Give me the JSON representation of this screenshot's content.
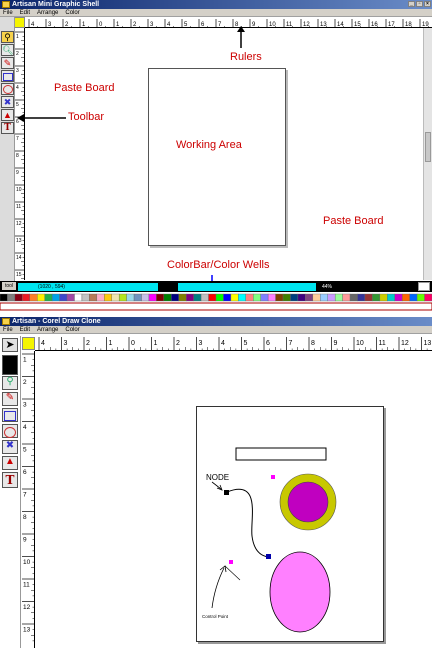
{
  "top_window": {
    "title": "Artisan Mini Graphic Shell",
    "menu": [
      "File",
      "Edit",
      "Arrange",
      "Color"
    ],
    "ruler_numbers": [
      "4",
      "3",
      "2",
      "1",
      "0",
      "1",
      "2",
      "3",
      "4",
      "5",
      "6",
      "7",
      "8",
      "9",
      "10",
      "11",
      "12",
      "13",
      "14",
      "15",
      "16",
      "17",
      "18",
      "19"
    ],
    "status_coords": "(1020 , 594)",
    "status_zoom": "44%",
    "status_tool": "tool",
    "annotations": {
      "rulers": "Rulers",
      "paste_board_left": "Paste Board",
      "toolbar": "Toolbar",
      "working_area": "Working Area",
      "paste_board_right": "Paste Board",
      "colorbar": "ColorBar/Color Wells"
    }
  },
  "bottom_window": {
    "title": "Artisan - Corel Draw Clone",
    "menu": [
      "File",
      "Edit",
      "Arrange",
      "Color"
    ],
    "ruler_numbers": [
      "4",
      "3",
      "2",
      "1",
      "0",
      "1",
      "2",
      "3",
      "4",
      "5",
      "6",
      "7",
      "8",
      "9",
      "10",
      "11",
      "12",
      "13"
    ],
    "vruler_numbers": [
      "1",
      "2",
      "3",
      "4",
      "5",
      "6",
      "7",
      "8",
      "9",
      "10",
      "11",
      "12",
      "13"
    ],
    "labels": {
      "node": "NODE",
      "control_point": "Control Point"
    }
  },
  "palette": [
    "#000000",
    "#7f7f7f",
    "#880015",
    "#ed1c24",
    "#ff7f27",
    "#fff200",
    "#22b14c",
    "#00a2e8",
    "#3f48cc",
    "#a349a4",
    "#ffffff",
    "#c3c3c3",
    "#b97a57",
    "#ffaec9",
    "#ffc90e",
    "#efe4b0",
    "#b5e61d",
    "#99d9ea",
    "#7092be",
    "#c8bfe7",
    "#ff00ff",
    "#800000",
    "#008000",
    "#000080",
    "#808000",
    "#800080",
    "#008080",
    "#c0c0c0",
    "#ff0000",
    "#00ff00",
    "#0000ff",
    "#ffff00",
    "#00ffff",
    "#ff8080",
    "#80ff80",
    "#8080ff",
    "#ff80ff",
    "#804000",
    "#408000",
    "#004080",
    "#400080",
    "#804080",
    "#ffcc99",
    "#99ccff",
    "#cc99ff",
    "#99ff99",
    "#ff9999",
    "#666666",
    "#333399",
    "#993333",
    "#339933",
    "#cccc00",
    "#00cccc",
    "#cc00cc",
    "#ff6600",
    "#0066ff",
    "#66ff00",
    "#ff0066"
  ],
  "colors": {
    "title_bar": "#0a246a",
    "annotation": "#cc0000",
    "cyan_status": "#00e5f0",
    "ring_outer": "#c8c800",
    "ring_inner": "#c000c0",
    "ellipse": "#ff80ff",
    "arrow_blue": "#0000ff"
  },
  "icons": [
    "pointer-icon",
    "zoom-icon",
    "pencil-icon",
    "rectangle-icon",
    "ellipse-icon",
    "color-fill-icon",
    "paint-icon",
    "text-icon"
  ]
}
